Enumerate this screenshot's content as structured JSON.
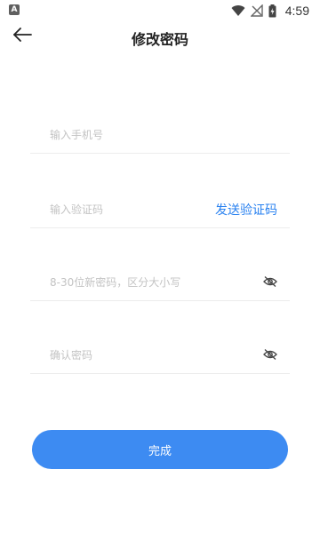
{
  "status_bar": {
    "app_icon_letter": "A",
    "time": "4:59",
    "battery_icon": "battery-charging-icon",
    "wifi_icon": "wifi-icon",
    "signal_icon": "no-signal-icon"
  },
  "header": {
    "back_icon": "arrow-left-icon",
    "title": "修改密码"
  },
  "form": {
    "phone_placeholder": "输入手机号",
    "code_placeholder": "输入验证码",
    "send_code_label": "发送验证码",
    "password_placeholder": "8-30位新密码，区分大小写",
    "confirm_placeholder": "确认密码",
    "eye_icon": "eye-off-icon"
  },
  "actions": {
    "submit_label": "完成"
  },
  "colors": {
    "accent": "#2a82f0",
    "button": "#3d8bf2",
    "divider": "#ececec",
    "placeholder": "#c3c3c3"
  }
}
